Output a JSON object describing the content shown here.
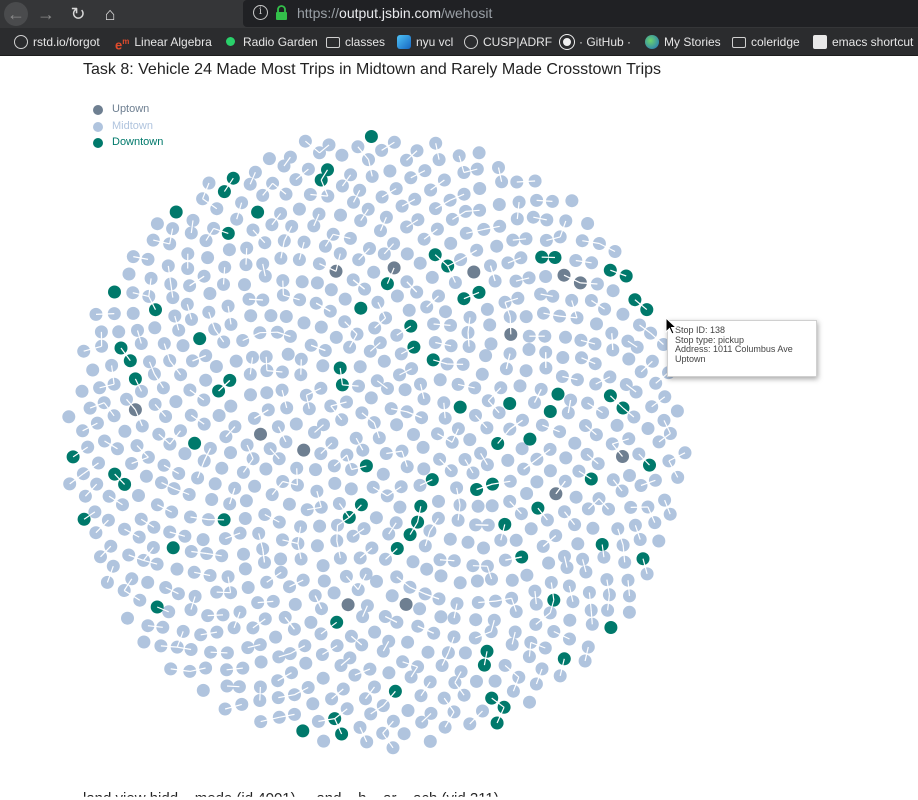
{
  "browser": {
    "url_scheme": "https://",
    "url_host": "output.jsbin.com",
    "url_path": "/wehosit",
    "bookmarks": [
      {
        "label": "rstd.io/forgot",
        "icon": "globe-icon"
      },
      {
        "label": "Linear Algebra",
        "icon": "em-logo-icon"
      },
      {
        "label": "Radio Garden",
        "icon": "green-dot-icon"
      },
      {
        "label": "classes",
        "icon": "folder-icon"
      },
      {
        "label": "nyu vcl",
        "icon": "nyu-app-icon"
      },
      {
        "label": "CUSP|ADRF",
        "icon": "globe-icon"
      },
      {
        "label": "· GitHub ·",
        "icon": "github-icon"
      },
      {
        "label": "My Stories",
        "icon": "earth-icon"
      },
      {
        "label": "coleridge",
        "icon": "folder-icon"
      },
      {
        "label": "emacs shortcut",
        "icon": "emacs-icon"
      }
    ]
  },
  "page": {
    "title": "Task 8: Vehicle 24 Made Most Trips in Midtown and Rarely Made Crosstown Trips",
    "bottom_text_partial": "land view hidd... mode (id 4001) ... and ...h ...ar ...ach (vid 211)"
  },
  "legend": [
    {
      "label": "Uptown",
      "color": "#6e7f91"
    },
    {
      "label": "Midtown",
      "color": "#b0c4de"
    },
    {
      "label": "Downtown",
      "color": "#00796b"
    }
  ],
  "tooltip": {
    "stop_id": "Stop ID: 138",
    "stop_type": "Stop type: pickup",
    "address": "Address: 1011 Columbus Ave",
    "region": "Uptown"
  },
  "colors": {
    "uptown": "#6e7f91",
    "midtown": "#b0c4de",
    "downtown": "#00796b",
    "link": "#ffffff"
  }
}
